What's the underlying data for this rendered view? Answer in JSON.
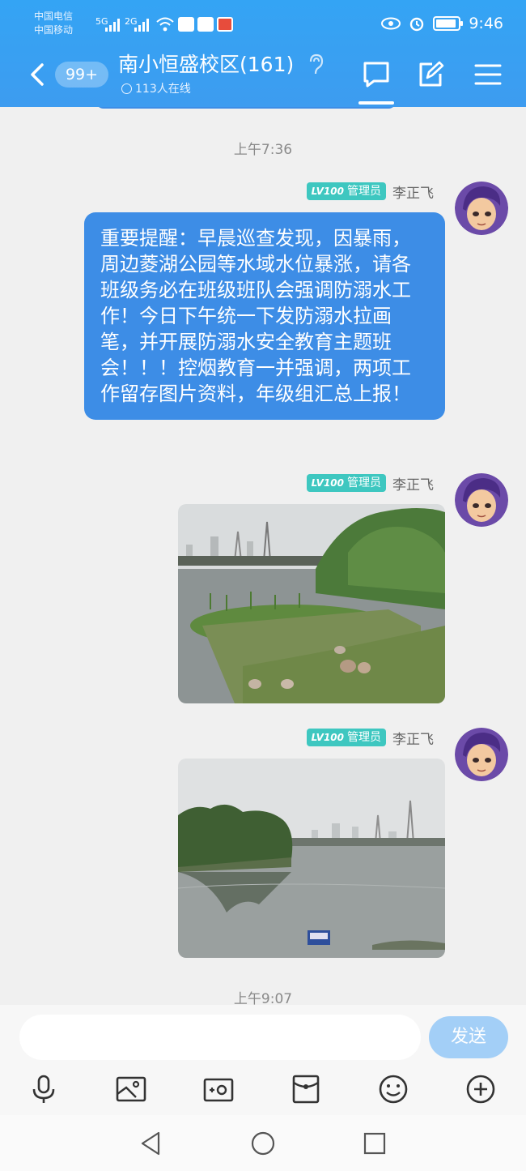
{
  "status_bar": {
    "carrier1": "中国电信",
    "carrier2": "中国移动",
    "sig1": "5G",
    "sig2": "2G",
    "time": "9:46"
  },
  "header": {
    "unread": "99+",
    "title": "南小恒盛校区(161)",
    "online": "113人在线"
  },
  "messages": [
    {
      "time": "上午7:36",
      "badge_level": "LV100",
      "badge_role": "管理员",
      "sender": "李正飞",
      "text": "重要提醒：早晨巡查发现，因暴雨，周边菱湖公园等水域水位暴涨，请各班级务必在班级班队会强调防溺水工作！今日下午统一下发防溺水拉画笔，并开展防溺水安全教育主题班会！！！控烟教育一并强调，两项工作留存图片资料，年级组汇总上报！"
    },
    {
      "badge_level": "LV100",
      "badge_role": "管理员",
      "sender": "李正飞",
      "image": "lake-photo-1"
    },
    {
      "badge_level": "LV100",
      "badge_role": "管理员",
      "sender": "李正飞",
      "image": "lake-photo-2"
    },
    {
      "time": "上午9:07"
    }
  ],
  "input_bar": {
    "send_label": "发送",
    "tools": [
      "microphone-icon",
      "image-icon",
      "camera-icon",
      "red-packet-icon",
      "emoji-icon",
      "plus-icon"
    ]
  },
  "colors": {
    "header": "#3d9cf0",
    "bubble": "#3d8de6",
    "badge": "#3ec7c0",
    "send_disabled": "#a3cff7"
  }
}
